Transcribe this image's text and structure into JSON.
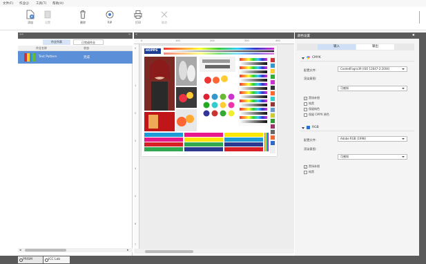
{
  "menu": [
    "文件(F)",
    "作业(J)",
    "工具(T)",
    "帮助(H)"
  ],
  "toolbar": {
    "add": "添加",
    "settings": "设置",
    "delete": "删除",
    "rip": "RIP",
    "print": "打印",
    "cancel": "取消"
  },
  "left_panel": {
    "tabs": [
      "作业列表",
      "已完成作业"
    ],
    "columns": [
      "作业名称",
      "状态"
    ],
    "rows": [
      {
        "name": "Test Pattern",
        "status": "完成"
      }
    ],
    "scroll_left": "◂",
    "scroll_right": "▸"
  },
  "bottom_tabs": [
    "PRISM",
    "ICC Lab"
  ],
  "right_panel": {
    "title": "颜色设置",
    "close": "✖",
    "tabs": [
      "输入",
      "输出"
    ],
    "cmyk": {
      "title": "CMYK",
      "profile_label": "配置文件:",
      "profile_value": "CoatedFogra39 (ISO 12647-2:2004)",
      "intent_label": "渲染意图:",
      "intent_value": "可感知",
      "checks": [
        {
          "label": "黑场补偿",
          "checked": true
        },
        {
          "label": "纯黑",
          "checked": false
        },
        {
          "label": "保留纯色",
          "checked": false
        },
        {
          "label": "保留 CMYK 原色",
          "checked": false
        }
      ]
    },
    "rgb": {
      "title": "RGB",
      "profile_label": "配置文件:",
      "profile_value": "Adobe RGB (1998)",
      "intent_label": "渲染意图:",
      "intent_value": "可感知",
      "checks": [
        {
          "label": "黑场补偿",
          "checked": true
        },
        {
          "label": "纯黑",
          "checked": false
        }
      ]
    }
  },
  "canvas": {
    "logo": "HOPPS",
    "ruler_top": [
      "0",
      "100",
      "200",
      "300",
      "400"
    ],
    "ruler_left": [
      "0",
      "1",
      "2",
      "3",
      "4",
      "5",
      "6",
      "7"
    ]
  },
  "colors": {
    "accent": "#5b8fd8",
    "panel_header": "#5b5b5b",
    "background": "#ededed"
  }
}
